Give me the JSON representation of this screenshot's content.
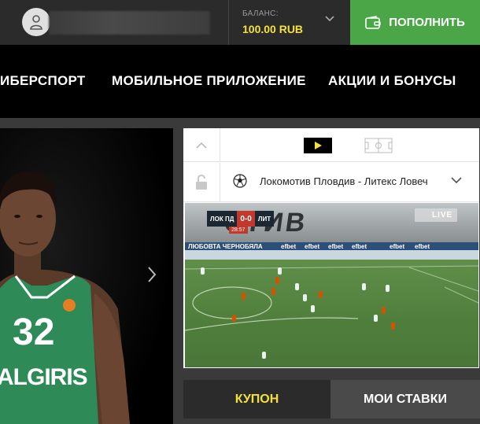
{
  "header": {
    "balance_label": "БАЛАНС:",
    "balance_value": "100.00 RUB",
    "topup_label": "ПОПОЛНИТЬ",
    "accent_yellow": "#f4e03a",
    "accent_green": "#4ba648"
  },
  "nav": {
    "items": [
      {
        "label": "ИБЕРСПОРТ"
      },
      {
        "label": "МОБИЛЬНОЕ ПРИЛОЖЕНИЕ"
      },
      {
        "label": "АКЦИИ И БОНУСЫ"
      }
    ]
  },
  "banner": {
    "jersey_number": "32",
    "jersey_text": "ALGIRIS"
  },
  "match": {
    "name": "Локомотив Пловдив - Литекс Ловеч",
    "score": {
      "home": "ЛОК ПД",
      "value": "0-0",
      "away": "ЛИТ",
      "time": "28:57"
    },
    "live_label": "LIVE",
    "stands_text": "СТИВ",
    "ad_board": [
      "ЛЮБОВТА ЧЕРНОБЯЛА",
      "efbet",
      "efbet",
      "efbet",
      "efbet",
      "efbet",
      "efbet"
    ]
  },
  "tabs": {
    "coupon": "КУПОН",
    "my_bets": "МОИ СТАВКИ"
  }
}
